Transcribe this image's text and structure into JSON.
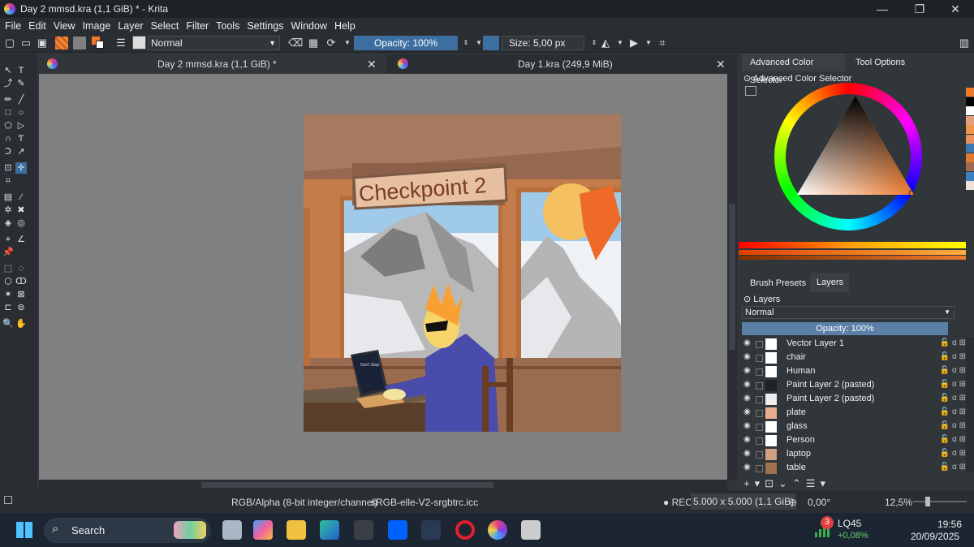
{
  "window": {
    "title": "Day 2 mmsd.kra (1,1 GiB) * - Krita",
    "minimize": "—",
    "maximize": "❐",
    "close": "✕"
  },
  "menu": [
    "File",
    "Edit",
    "View",
    "Image",
    "Layer",
    "Select",
    "Filter",
    "Tools",
    "Settings",
    "Window",
    "Help"
  ],
  "toolbar": {
    "blend_mode": "Normal",
    "opacity": "Opacity: 100%",
    "size": "Size: 5,00 px"
  },
  "tabs": [
    {
      "label": "Day 2 mmsd.kra (1,1 GiB) *",
      "close": "✕"
    },
    {
      "label": "Day 1.kra (249,9 MiB)",
      "close": "✕"
    }
  ],
  "artwork": {
    "sign_text": "Checkpoint 2",
    "laptop_text": "Don't Stop"
  },
  "docker": {
    "tabs_top": [
      "Advanced Color Selector",
      "Tool Options"
    ],
    "color_selector_title": "Advanced Color Selector",
    "tabs_mid": [
      "Brush Presets",
      "Layers"
    ],
    "layers_title": "Layers",
    "blend_mode": "Normal",
    "opacity": "Opacity: 100%",
    "layers": [
      "Vector Layer 1",
      "chair",
      "Human",
      "Paint Layer 2 (pasted)",
      "Paint Layer 2 (pasted)",
      "plate",
      "glass",
      "Person",
      "laptop",
      "table"
    ],
    "palette": [
      "#f07a2a",
      "#000000",
      "#ffffff",
      "#e6a080",
      "#f0944a",
      "#e89060",
      "#3c78b0",
      "#e07830",
      "#a06a50",
      "#3c80c0",
      "#f0e0d8"
    ]
  },
  "status": {
    "color_space": "RGB/Alpha (8-bit integer/channel)",
    "profile": "sRGB-elle-V2-srgbtrc.icc",
    "rec": "● REC",
    "dimensions": "5.000 x 5.000 (1,1 GiB)",
    "rotation": "0,00°",
    "zoom": "12,5%"
  },
  "taskbar": {
    "search": "Search",
    "stock_badge": "3",
    "stock_name": "LQ45",
    "stock_change": "+0,08%",
    "time": "19:56",
    "date": "20/09/2025"
  }
}
